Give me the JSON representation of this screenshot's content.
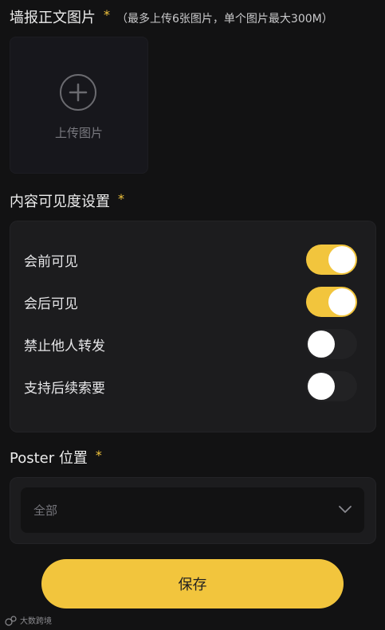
{
  "upload": {
    "title": "墙报正文图片",
    "required_mark": "*",
    "hint": "（最多上传6张图片，单个图片最大300M）",
    "button_label": "上传图片",
    "icon": "plus-circle-icon"
  },
  "visibility": {
    "title": "内容可见度设置",
    "required_mark": "*",
    "items": [
      {
        "label": "会前可见",
        "on": true
      },
      {
        "label": "会后可见",
        "on": true
      },
      {
        "label": "禁止他人转发",
        "on": false
      },
      {
        "label": "支持后续索要",
        "on": false
      }
    ]
  },
  "poster_position": {
    "title": "Poster 位置",
    "required_mark": "*",
    "selected_value": "全部",
    "icon": "chevron-down-icon"
  },
  "save_button": {
    "label": "保存"
  },
  "watermark": {
    "text": "大数跨境"
  },
  "colors": {
    "background": "#121213",
    "card": "#1c1c1e",
    "accent": "#f2c53d",
    "toggle_off_track": "#222224",
    "text_primary": "#ececec",
    "text_muted": "#75757b"
  }
}
